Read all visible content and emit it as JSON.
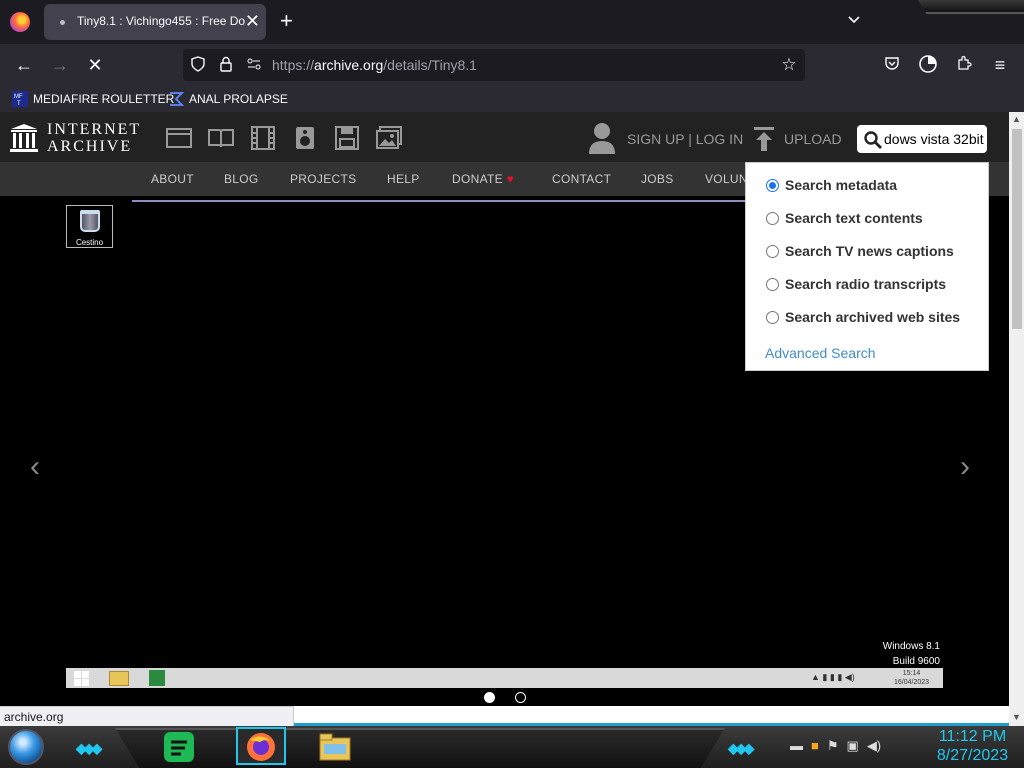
{
  "browser": {
    "tab_title": "Tiny8.1 : Vichingo455 : Free Do",
    "new_tab_symbol": "+",
    "url_prefix": "https://",
    "url_domain": "archive.org",
    "url_path": "/details/Tiny8.1",
    "bookmarks": [
      {
        "label": "MEDIAFIRE ROULETTER",
        "icon": "mft-icon"
      },
      {
        "label": "ANAL PROLAPSE",
        "icon": "sigma-icon"
      }
    ],
    "status_link": "archive.org"
  },
  "site": {
    "logo_line1": "INTERNET",
    "logo_line2": "ARCHIVE",
    "signup": "SIGN UP | LOG IN",
    "upload": "UPLOAD",
    "search_value": "dows vista 32bit",
    "subnav": [
      "ABOUT",
      "BLOG",
      "PROJECTS",
      "HELP",
      "DONATE",
      "CONTACT",
      "JOBS",
      "VOLUN"
    ],
    "heart": "♥",
    "search_options": [
      {
        "label": "Search metadata",
        "checked": true
      },
      {
        "label": "Search text contents",
        "checked": false
      },
      {
        "label": "Search TV news captions",
        "checked": false
      },
      {
        "label": "Search radio transcripts",
        "checked": false
      },
      {
        "label": "Search archived web sites",
        "checked": false
      }
    ],
    "advanced_search": "Advanced Search"
  },
  "preview": {
    "desktop_icon_label": "Cestino",
    "os_name": "Windows 8.1",
    "os_build": "Build 9600",
    "inner_time": "15:14",
    "inner_date": "16/04/2023"
  },
  "taskbar": {
    "time": "11:12 PM",
    "date": "8/27/2023"
  },
  "colors": {
    "accent_blue": "#1a73e8",
    "taskbar_cyan": "#20c8f0",
    "donate_red": "#e0112b"
  }
}
